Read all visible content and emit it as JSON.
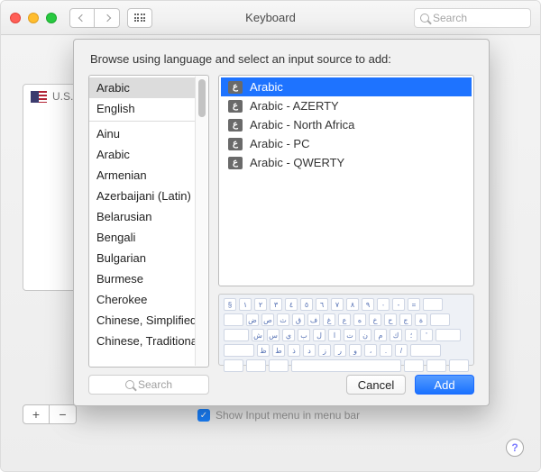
{
  "window": {
    "title": "Keyboard",
    "search_placeholder": "Search"
  },
  "sidebar": {
    "items": [
      {
        "label": "U.S."
      }
    ]
  },
  "footer": {
    "showmenu_label": "Show Input menu in menu bar"
  },
  "sheet": {
    "title": "Browse using language and select an input source to add:",
    "languages_top": [
      "Arabic",
      "English"
    ],
    "languages": [
      "Ainu",
      "Arabic",
      "Armenian",
      "Azerbaijani (Latin)",
      "Belarusian",
      "Bengali",
      "Bulgarian",
      "Burmese",
      "Cherokee",
      "Chinese, Simplified",
      "Chinese, Traditional"
    ],
    "sources": [
      "Arabic",
      "Arabic - AZERTY",
      "Arabic - North Africa",
      "Arabic - PC",
      "Arabic - QWERTY"
    ],
    "search_placeholder": "Search",
    "cancel_label": "Cancel",
    "add_label": "Add",
    "kbd_icon_glyph": "ع",
    "keyboard_rows": [
      [
        "§",
        "١",
        "٢",
        "٣",
        "٤",
        "٥",
        "٦",
        "٧",
        "٨",
        "٩",
        "٠",
        "-",
        "="
      ],
      [
        "ض",
        "ص",
        "ث",
        "ق",
        "ف",
        "غ",
        "ع",
        "ه",
        "خ",
        "ح",
        "ج",
        "ة"
      ],
      [
        "ش",
        "س",
        "ي",
        "ب",
        "ل",
        "ا",
        "ت",
        "ن",
        "م",
        "ك",
        "؛",
        "'"
      ],
      [
        "ظ",
        "ط",
        "ذ",
        "د",
        "ز",
        "ر",
        "و",
        "،",
        ".",
        "/"
      ]
    ]
  }
}
